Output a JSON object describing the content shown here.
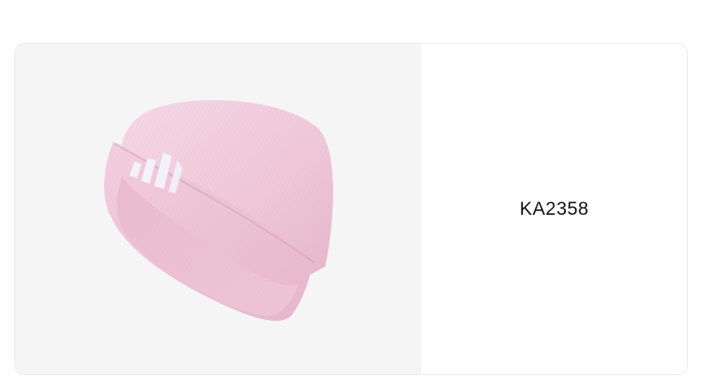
{
  "product": {
    "code": "KA2358",
    "image_icon": "beanie-product-image",
    "colors": {
      "hat_main": "#efc6d6",
      "hat_shadow": "#e2b0c4",
      "hat_highlight": "#f6d7e3",
      "logo": "#f4f2f8",
      "image_background": "#f5f5f5"
    }
  }
}
